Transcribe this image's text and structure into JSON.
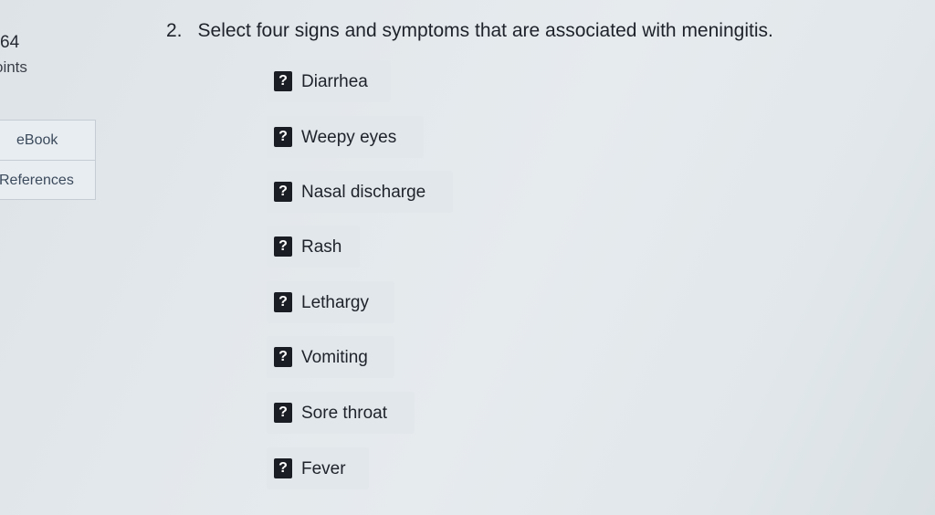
{
  "sidebar": {
    "points_value": "64",
    "points_label": "oints",
    "tools": [
      {
        "label": "eBook"
      },
      {
        "label": "References"
      }
    ]
  },
  "question": {
    "number": "2.",
    "text": "Select four signs and symptoms that are associated with meningitis."
  },
  "options": [
    {
      "badge": "?",
      "label": "Diarrhea"
    },
    {
      "badge": "?",
      "label": "Weepy eyes"
    },
    {
      "badge": "?",
      "label": "Nasal discharge"
    },
    {
      "badge": "?",
      "label": "Rash"
    },
    {
      "badge": "?",
      "label": "Lethargy"
    },
    {
      "badge": "?",
      "label": "Vomiting"
    },
    {
      "badge": "?",
      "label": "Sore throat"
    },
    {
      "badge": "?",
      "label": "Fever"
    }
  ]
}
